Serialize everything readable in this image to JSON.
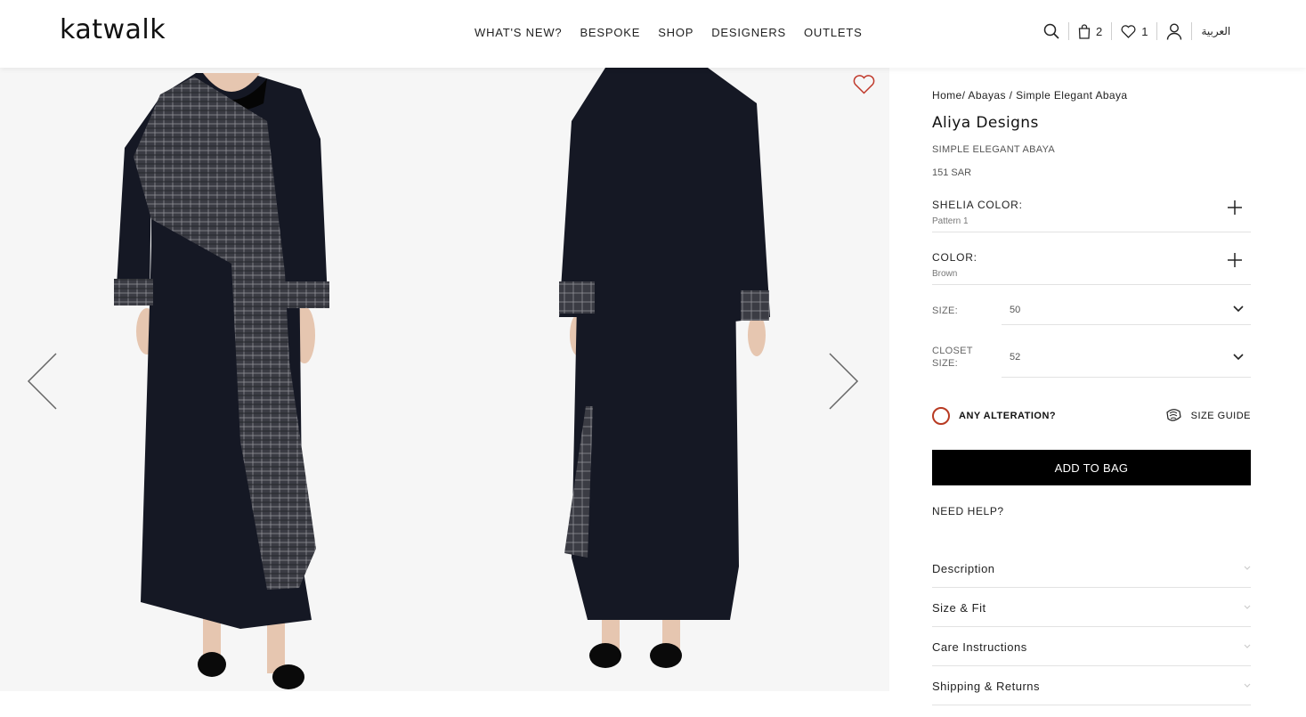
{
  "header": {
    "logo": "katwalk",
    "nav": [
      "WHAT'S NEW?",
      "BESPOKE",
      "SHOP",
      "DESIGNERS",
      "OUTLETS"
    ],
    "bag_count": "2",
    "wishlist_count": "1",
    "language": "العربية"
  },
  "breadcrumb": {
    "home": "Home/",
    "category": "Abayas",
    "separator": "/",
    "current": "Simple Elegant Abaya"
  },
  "product": {
    "brand": "Aliya Designs",
    "name": "SIMPLE ELEGANT ABAYA",
    "price": "151 SAR"
  },
  "options": {
    "shelia_color_label": "SHELIA COLOR:",
    "shelia_color_value": "Pattern 1",
    "color_label": "COLOR:",
    "color_value": "Brown",
    "size_label": "SIZE:",
    "size_value": "50",
    "closet_size_label": "CLOSET SIZE:",
    "closet_size_value": "52"
  },
  "actions": {
    "alteration_label": "ANY ALTERATION?",
    "size_guide_label": "SIZE GUIDE",
    "add_to_bag": "ADD TO BAG",
    "need_help": "NEED HELP?"
  },
  "accordion": [
    "Description",
    "Size & Fit",
    "Care Instructions",
    "Shipping & Returns"
  ],
  "colors": {
    "accent": "#b83a22",
    "button_bg": "#000000",
    "garment": "#151824",
    "gallery_bg": "#f6f6f6"
  },
  "icons": [
    "search-icon",
    "bag-icon",
    "heart-icon",
    "user-icon",
    "chevron-left-icon",
    "chevron-right-icon",
    "wishlist-heart-icon",
    "plus-icon",
    "chevron-down-icon",
    "size-guide-icon"
  ]
}
